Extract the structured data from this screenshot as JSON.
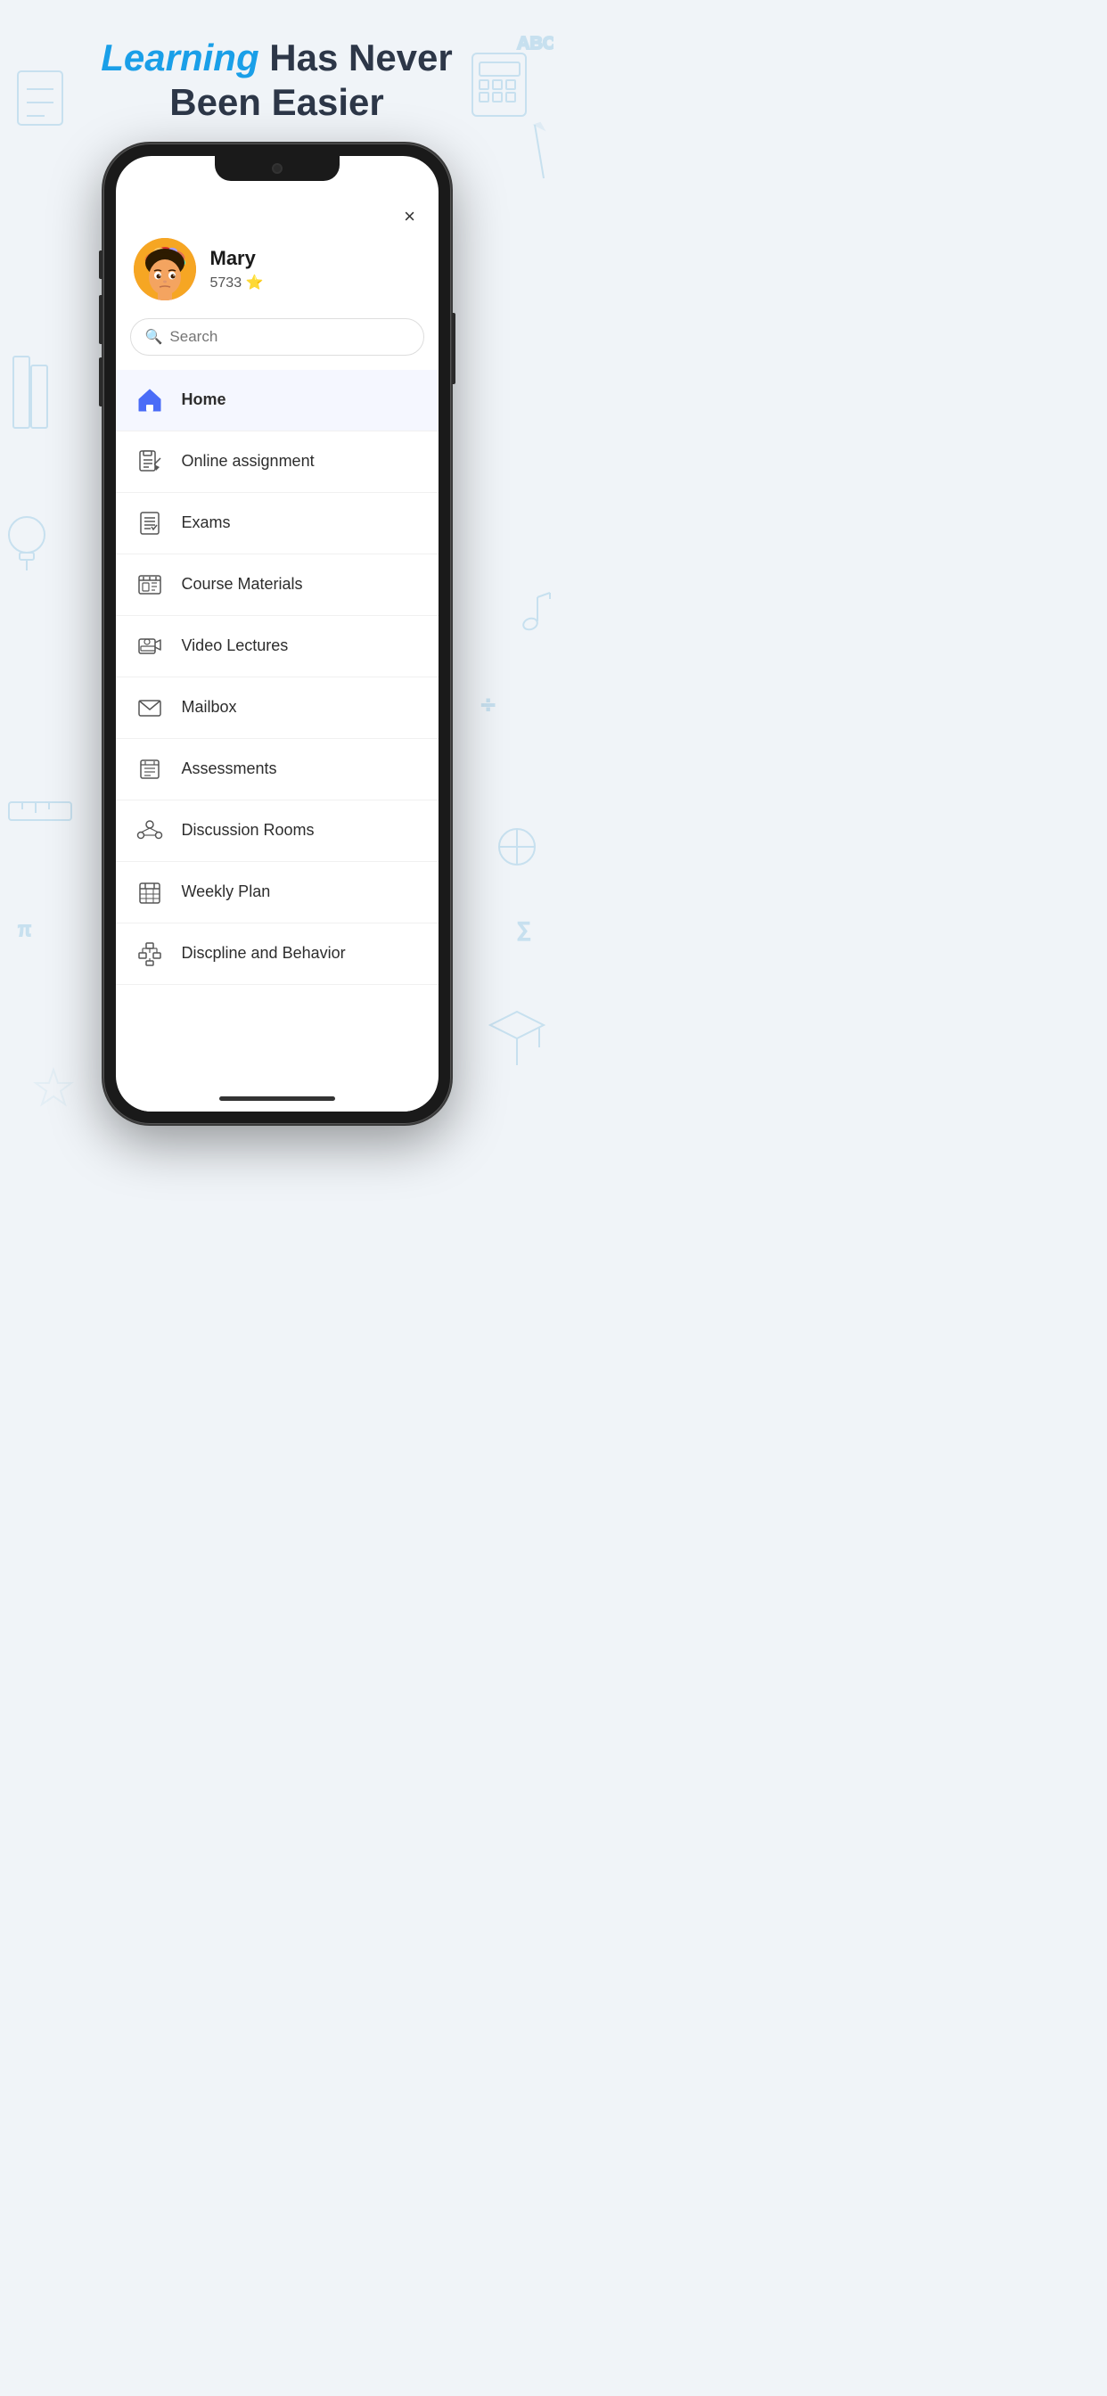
{
  "header": {
    "line1_highlight": "Learning",
    "line1_rest": " Has Never",
    "line2": "Been Easier"
  },
  "user": {
    "name": "Mary",
    "points": "5733",
    "star": "⭐"
  },
  "search": {
    "placeholder": "Search"
  },
  "close_button": "×",
  "menu_items": [
    {
      "id": "home",
      "label": "Home",
      "active": true
    },
    {
      "id": "online-assignment",
      "label": "Online assignment",
      "active": false
    },
    {
      "id": "exams",
      "label": "Exams",
      "active": false
    },
    {
      "id": "course-materials",
      "label": "Course Materials",
      "active": false
    },
    {
      "id": "video-lectures",
      "label": "Video Lectures",
      "active": false
    },
    {
      "id": "mailbox",
      "label": "Mailbox",
      "active": false
    },
    {
      "id": "assessments",
      "label": "Assessments",
      "active": false
    },
    {
      "id": "discussion-rooms",
      "label": "Discussion Rooms",
      "active": false
    },
    {
      "id": "weekly-plan",
      "label": "Weekly Plan",
      "active": false
    },
    {
      "id": "discipline-behavior",
      "label": "Discpline and Behavior",
      "active": false
    }
  ],
  "colors": {
    "highlight": "#1a9fe8",
    "dark": "#2d3748",
    "active_bg": "#f0f4ff"
  }
}
